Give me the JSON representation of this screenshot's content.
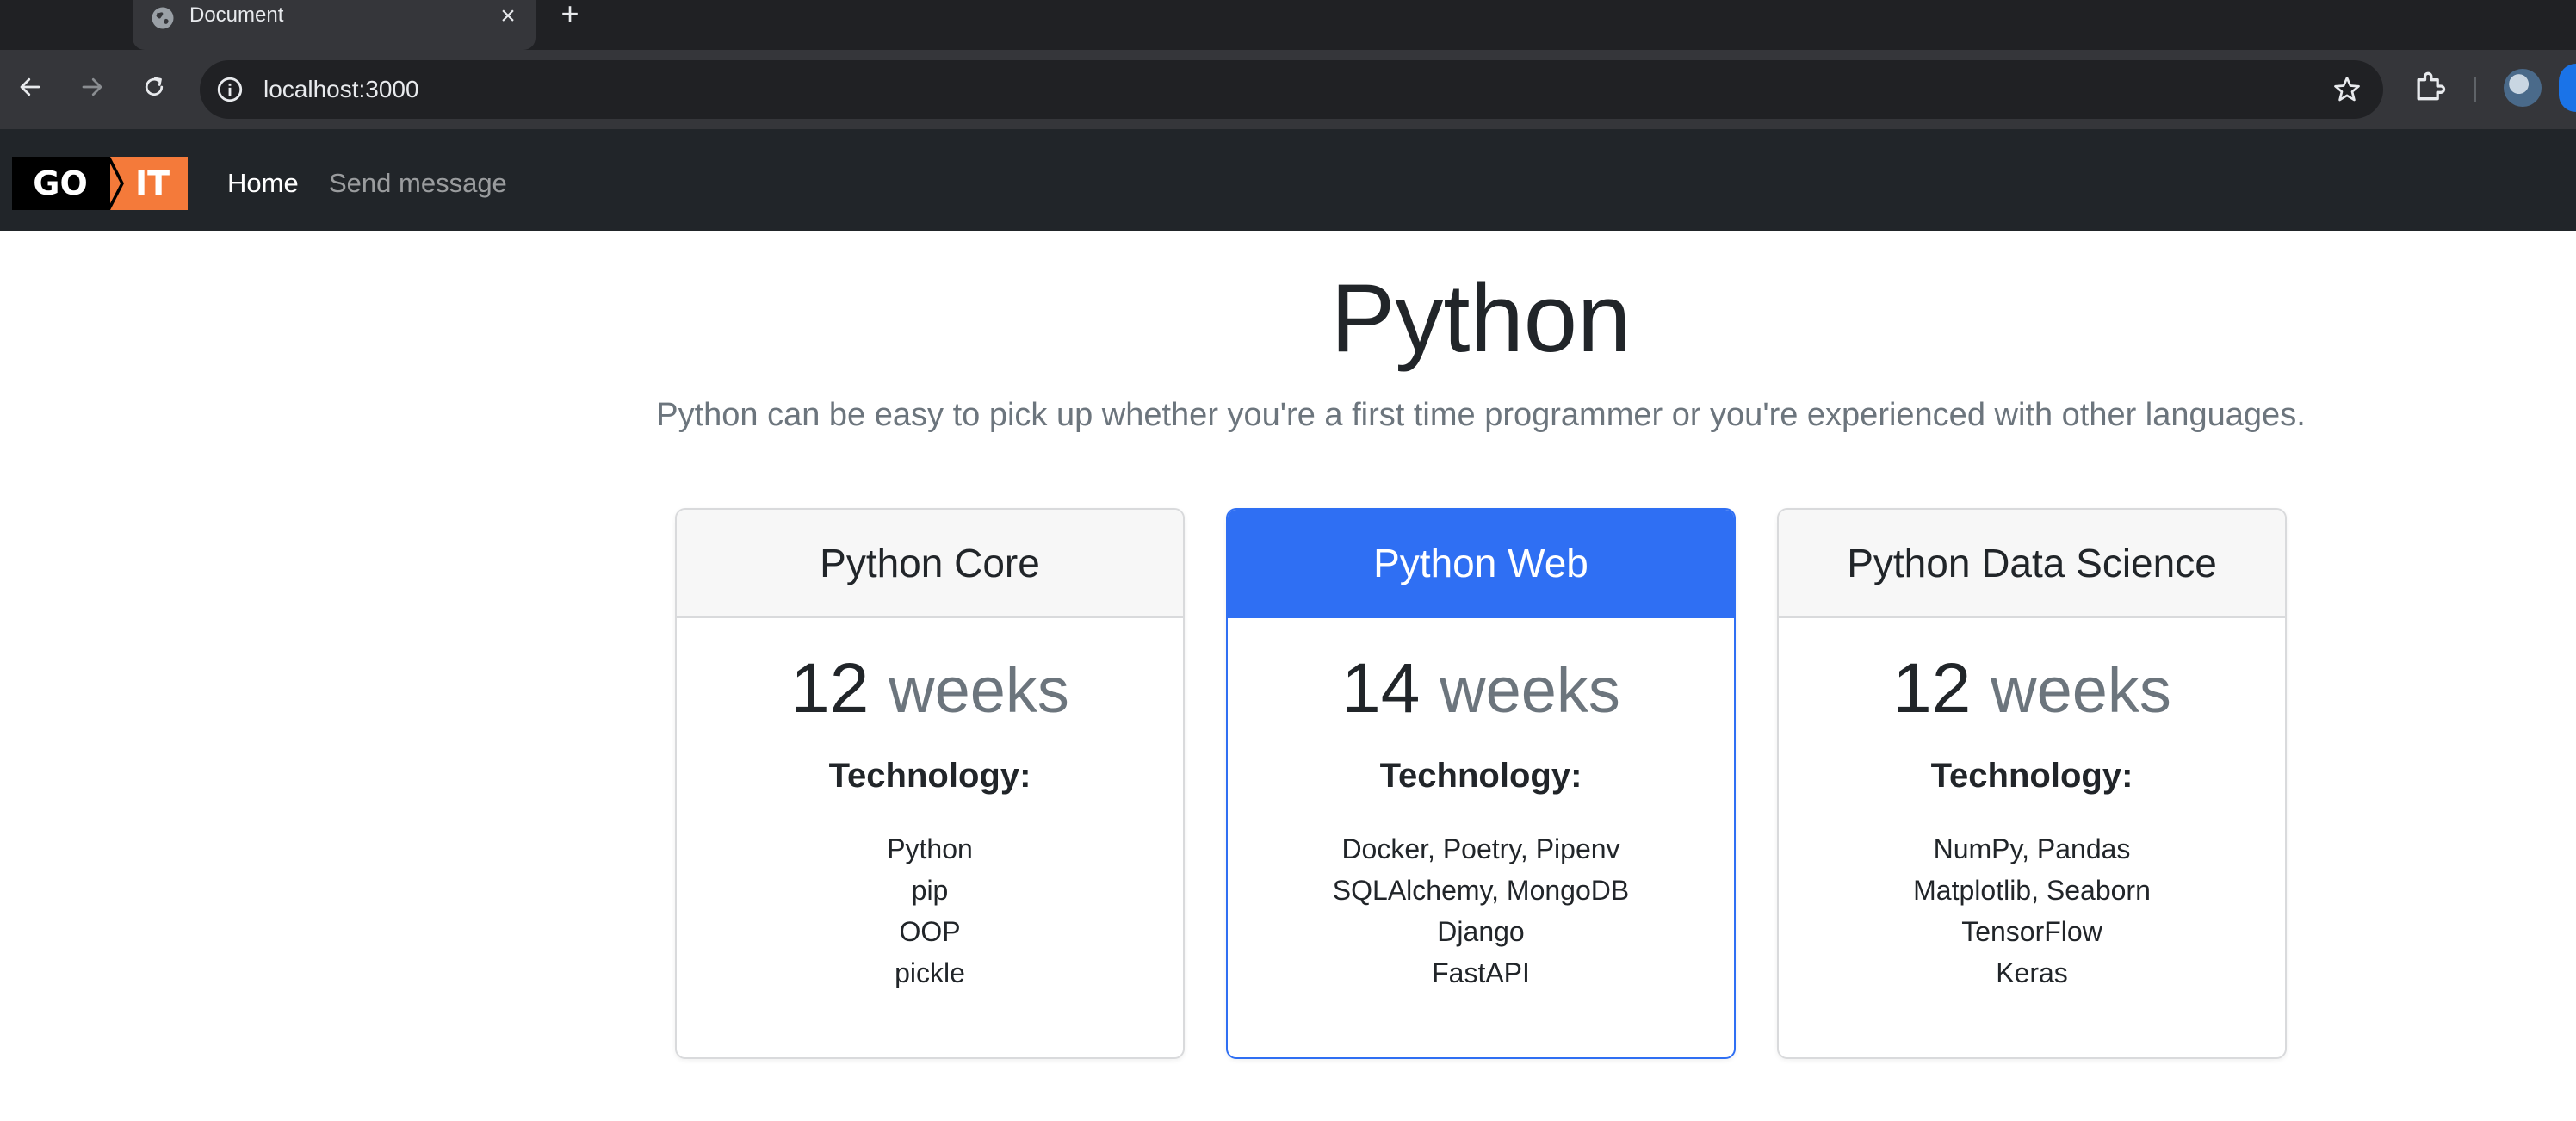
{
  "browser": {
    "tab_title": "Document",
    "tab_close": "×",
    "new_tab": "+",
    "url": "localhost:3000"
  },
  "navbar": {
    "logo_left": "GO",
    "logo_right": "IT",
    "links": [
      {
        "label": "Home",
        "active": true
      },
      {
        "label": "Send message",
        "active": false
      }
    ]
  },
  "hero": {
    "title": "Python",
    "lead": "Python can be easy to pick up whether you're a first time programmer or you're experienced with other languages."
  },
  "cards": [
    {
      "title": "Python Core",
      "duration": "12",
      "unit": "weeks",
      "tech_label": "Technology:",
      "items": [
        "Python",
        "pip",
        "OOP",
        "pickle"
      ]
    },
    {
      "title": "Python Web",
      "duration": "14",
      "unit": "weeks",
      "tech_label": "Technology:",
      "items": [
        "Docker, Poetry, Pipenv",
        "SQLAlchemy, MongoDB",
        "Django",
        "FastAPI"
      ]
    },
    {
      "title": "Python Data Science",
      "duration": "12",
      "unit": "weeks",
      "tech_label": "Technology:",
      "items": [
        "NumPy, Pandas",
        "Matplotlib, Seaborn",
        "TensorFlow",
        "Keras"
      ]
    }
  ],
  "colors": {
    "navbar_bg": "#212529",
    "accent": "#2f6ff3",
    "logo_orange": "#f47a3a",
    "muted_text": "#6c757d"
  }
}
